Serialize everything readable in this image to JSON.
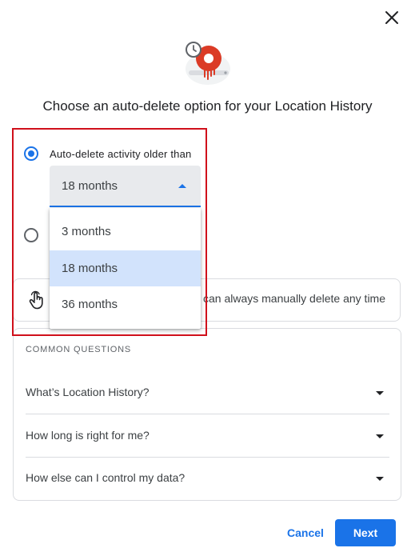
{
  "dialog": {
    "title": "Choose an auto-delete option for your Location History"
  },
  "options": {
    "auto_delete_label": "Auto-delete activity older than",
    "selected_value": "18 months",
    "menu_items": [
      "3 months",
      "18 months",
      "36 months"
    ],
    "menu_selected_index": 1
  },
  "tip": {
    "text": "can always manually delete any time"
  },
  "faq": {
    "heading": "COMMON QUESTIONS",
    "items": [
      "What’s Location History?",
      "How long is right for me?",
      "How else can I control my data?"
    ]
  },
  "buttons": {
    "cancel": "Cancel",
    "next": "Next"
  },
  "icons": {
    "close": "close-icon",
    "hero": "auto-delete-clock-icon",
    "tip": "touch-hand-icon",
    "select_caret": "caret-up-icon",
    "faq_caret": "caret-down-icon"
  },
  "colors": {
    "accent": "#1a73e8",
    "highlight_box": "#d0101b",
    "hero_red": "#db3b26",
    "menu_selected_bg": "#d2e3fc"
  }
}
